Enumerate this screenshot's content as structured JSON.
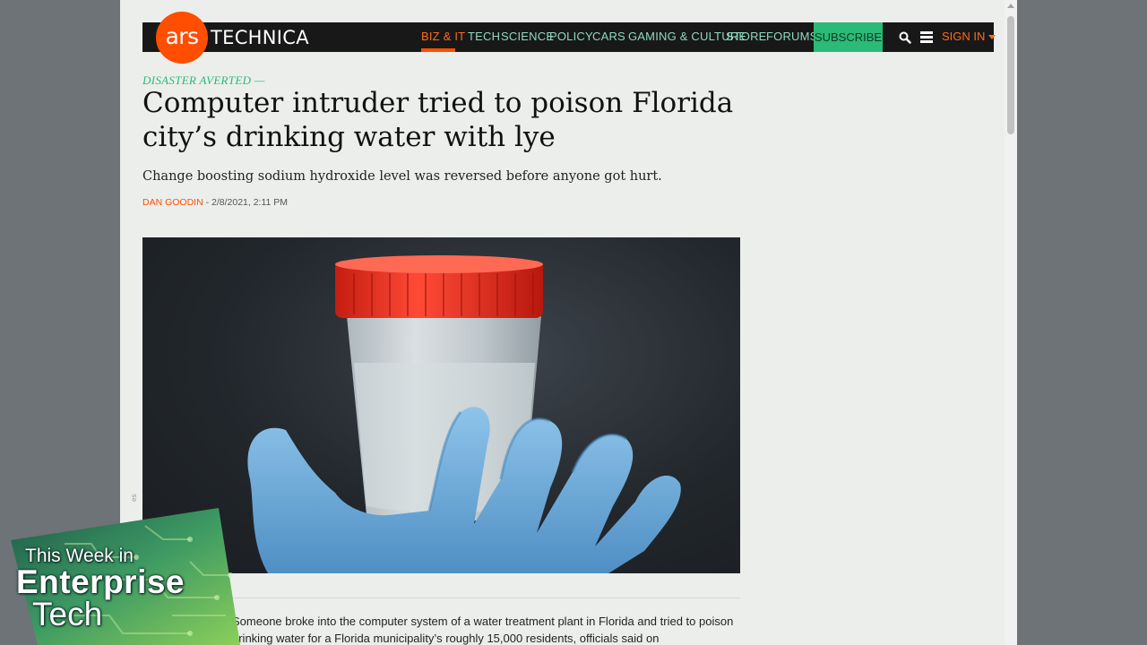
{
  "header": {
    "logo_ars": "ars",
    "logo_technica": "TECHNICA",
    "nav": [
      {
        "label": "BIZ & IT",
        "active": true
      },
      {
        "label": "TECH"
      },
      {
        "label": "SCIENCE"
      },
      {
        "label": "POLICY"
      },
      {
        "label": "CARS"
      },
      {
        "label": "GAMING & CULTURE"
      },
      {
        "label": "STORE"
      },
      {
        "label": "FORUMS"
      }
    ],
    "subscribe": "SUBSCRIBE",
    "search_icon": "search-icon",
    "menu_icon": "hamburger-menu-icon",
    "sign_in": "SIGN IN"
  },
  "article": {
    "kicker": "DISASTER AVERTED —",
    "headline": "Computer intruder tried to poison Florida city’s drinking water with lye",
    "dek": "Change boosting sodium hydroxide level was reversed before anyone got hurt.",
    "author": "DAN GOODIN",
    "date": " - 2/8/2021, 2:11 PM",
    "photo_credit": "es",
    "body": "Someone broke into the computer system of a water treatment plant in Florida and tried to poison drinking water for a Florida municipality’s roughly 15,000 residents, officials said on"
  },
  "overlay": {
    "line1": "This Week in",
    "line2": "Enterprise",
    "line3": "Tech"
  },
  "colors": {
    "brand_orange": "#ff4e00",
    "nav_text": "#8fd8c1",
    "subscribe_bg": "#2bba77",
    "kicker": "#2bba77"
  }
}
